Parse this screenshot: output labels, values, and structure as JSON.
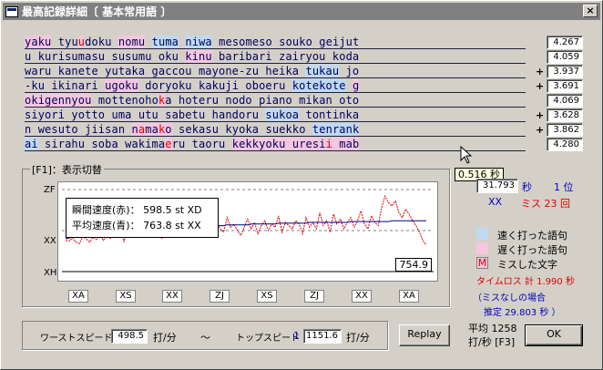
{
  "window": {
    "title": "最高記録詳細〔 基本常用語 〕",
    "close_label": "×"
  },
  "typing_lines": [
    [
      {
        "t": "yaku",
        "k": "slow"
      },
      {
        "t": " "
      },
      {
        "t": "tyu"
      },
      {
        "t": "u",
        "k": "miss"
      },
      {
        "t": "doku "
      },
      {
        "t": "nomu",
        "k": "slow"
      },
      {
        "t": " "
      },
      {
        "t": "tuma",
        "k": "fast"
      },
      {
        "t": " "
      },
      {
        "t": "niwa",
        "k": "fast"
      },
      {
        "t": " mesomeso souko geijut"
      }
    ],
    [
      {
        "t": "u kurisumasu susumu oku "
      },
      {
        "t": "kinu",
        "k": "slow"
      },
      {
        "t": " baribari zairyou koda"
      }
    ],
    [
      {
        "t": "waru kanete yutaka gaccou mayone-zu heika "
      },
      {
        "t": "tukau",
        "k": "fast"
      },
      {
        "t": " jo"
      }
    ],
    [
      {
        "t": "-ku ikinari "
      },
      {
        "t": "ugoku",
        "k": "slow"
      },
      {
        "t": " doryoku kakuji oboeru "
      },
      {
        "t": "kotekote",
        "k": "fast"
      },
      {
        "t": " "
      },
      {
        "t": "g",
        "k": "slow"
      }
    ],
    [
      {
        "t": "o",
        "k": "slow"
      },
      {
        "t": "kigennyou",
        "k": "slow"
      },
      {
        "t": " mottenoho"
      },
      {
        "t": "k",
        "k": "miss"
      },
      {
        "t": "a hoteru nodo piano mikan oto"
      }
    ],
    [
      {
        "t": "siyori yotto uma utu sabetu handoru "
      },
      {
        "t": "sukoa",
        "k": "fast"
      },
      {
        "t": " tontinka"
      }
    ],
    [
      {
        "t": "n wesuto jiisan "
      },
      {
        "t": "n",
        "k": "slow"
      },
      {
        "t": "a",
        "k": "miss"
      },
      {
        "t": "ma",
        "k": "slow"
      },
      {
        "t": "k",
        "k": "miss"
      },
      {
        "t": "o",
        "k": "slow"
      },
      {
        "t": " sekasu kyoka suekko "
      },
      {
        "t": "tenrank",
        "k": "fast"
      }
    ],
    [
      {
        "t": "ai",
        "k": "fast"
      },
      {
        "t": " sirahu soba wakima"
      },
      {
        "t": "e",
        "k": "miss"
      },
      {
        "t": "ru taoru "
      },
      {
        "t": "kekkyoku",
        "k": "slow"
      },
      {
        "t": " uresi",
        "k": "slow"
      },
      {
        "t": "i",
        "k": "miss"
      },
      {
        "t": " mab",
        "k": "slow"
      }
    ]
  ],
  "scores": [
    {
      "sign": "",
      "value": "4.267"
    },
    {
      "sign": "",
      "value": "4.059"
    },
    {
      "sign": "+",
      "value": "3.937"
    },
    {
      "sign": "+",
      "value": "3.691"
    },
    {
      "sign": "",
      "value": "4.069"
    },
    {
      "sign": "+",
      "value": "3.628"
    },
    {
      "sign": "+",
      "value": "3.862"
    },
    {
      "sign": "",
      "value": "4.280"
    }
  ],
  "tooltip": "0.516 秒",
  "graph": {
    "group_label": "[F1]：表示切替",
    "y_top": "ZF",
    "y_mid": "XX",
    "y_bottom": "XH",
    "instant_label": "瞬間速度(赤)：",
    "instant_value": "598.5 st  XD",
    "average_label": "平均速度(青)：",
    "average_value": "763.8 st  XX",
    "current_value": "754.9",
    "x_labels": [
      "XA",
      "XS",
      "XX",
      "ZJ",
      "XS",
      "ZJ",
      "XX",
      "XA"
    ],
    "instant_series": [
      38,
      37,
      41,
      36,
      34,
      43,
      40,
      36,
      42,
      39,
      45,
      38,
      44,
      40,
      48,
      46,
      52,
      36,
      58,
      54,
      60,
      50,
      42,
      55,
      44,
      52,
      48,
      58,
      40,
      46,
      52,
      60,
      45,
      54,
      48,
      56,
      50,
      58,
      46,
      62,
      52,
      56,
      44,
      50,
      60,
      52,
      48,
      66,
      54,
      58,
      50,
      44,
      54,
      64,
      52,
      60,
      46,
      56,
      62,
      50,
      58,
      54,
      68,
      48,
      60,
      56,
      52,
      62,
      58,
      46,
      66,
      54,
      60,
      52,
      72,
      56,
      62,
      48,
      70,
      58,
      64,
      52,
      60,
      66,
      54,
      62,
      74,
      58,
      52,
      68,
      60,
      56,
      78,
      92,
      84,
      80,
      86,
      72,
      66,
      76,
      70,
      62,
      56,
      48,
      38,
      32
    ],
    "average_series": [
      40,
      41,
      42,
      43,
      43,
      44,
      45,
      45,
      46,
      46,
      47,
      47,
      48,
      48,
      49,
      49,
      49,
      50,
      50,
      50,
      51,
      51,
      51,
      52,
      52,
      52,
      52,
      53,
      53,
      53,
      53,
      54,
      54,
      54,
      54,
      54,
      55,
      55,
      55,
      55,
      55,
      56,
      56,
      56,
      56,
      56,
      56,
      57,
      57,
      57,
      57,
      57,
      57,
      57,
      58,
      58,
      58,
      58,
      58,
      58,
      58,
      58,
      59,
      59,
      59,
      59,
      59,
      59,
      59,
      59,
      59,
      60,
      60,
      60,
      60,
      60,
      60,
      60,
      60,
      60,
      60,
      60,
      60,
      61,
      61,
      61,
      61,
      61,
      61,
      61,
      61,
      61,
      61,
      61,
      61,
      62,
      62,
      62,
      62,
      62,
      62,
      62,
      62,
      62,
      62,
      62
    ],
    "y_range": [
      0,
      100
    ]
  },
  "result": {
    "time_value": "31.793",
    "time_unit": "秒",
    "rank_label": "1 位",
    "grade": "XX",
    "miss_label": "ミス 23 回"
  },
  "legend": {
    "fast_label": "速く打った語句",
    "slow_label": "遅く打った語句",
    "miss_mark": "M",
    "miss_label": "ミスした文字",
    "colors": {
      "fast": "#bfd9f2",
      "slow": "#f6c6de",
      "miss": "#e00000"
    }
  },
  "loss": {
    "line1": "タイムロス  計  1.990 秒",
    "line2": "（ミスなしの場合",
    "line3": "推定      29.803 秒 ）"
  },
  "speeds": {
    "worst_label": "ワーストスピード",
    "worst_value": "498.5",
    "unit": "打/分",
    "tilde": "〜",
    "top_label": "トップスピード",
    "top_mark": "1",
    "top_value": "1151.6",
    "unit2": "打/分"
  },
  "average": {
    "line1": "平均 1258",
    "line2": "打/秒 [F3]"
  },
  "buttons": {
    "replay": "Replay",
    "ok": "OK"
  }
}
